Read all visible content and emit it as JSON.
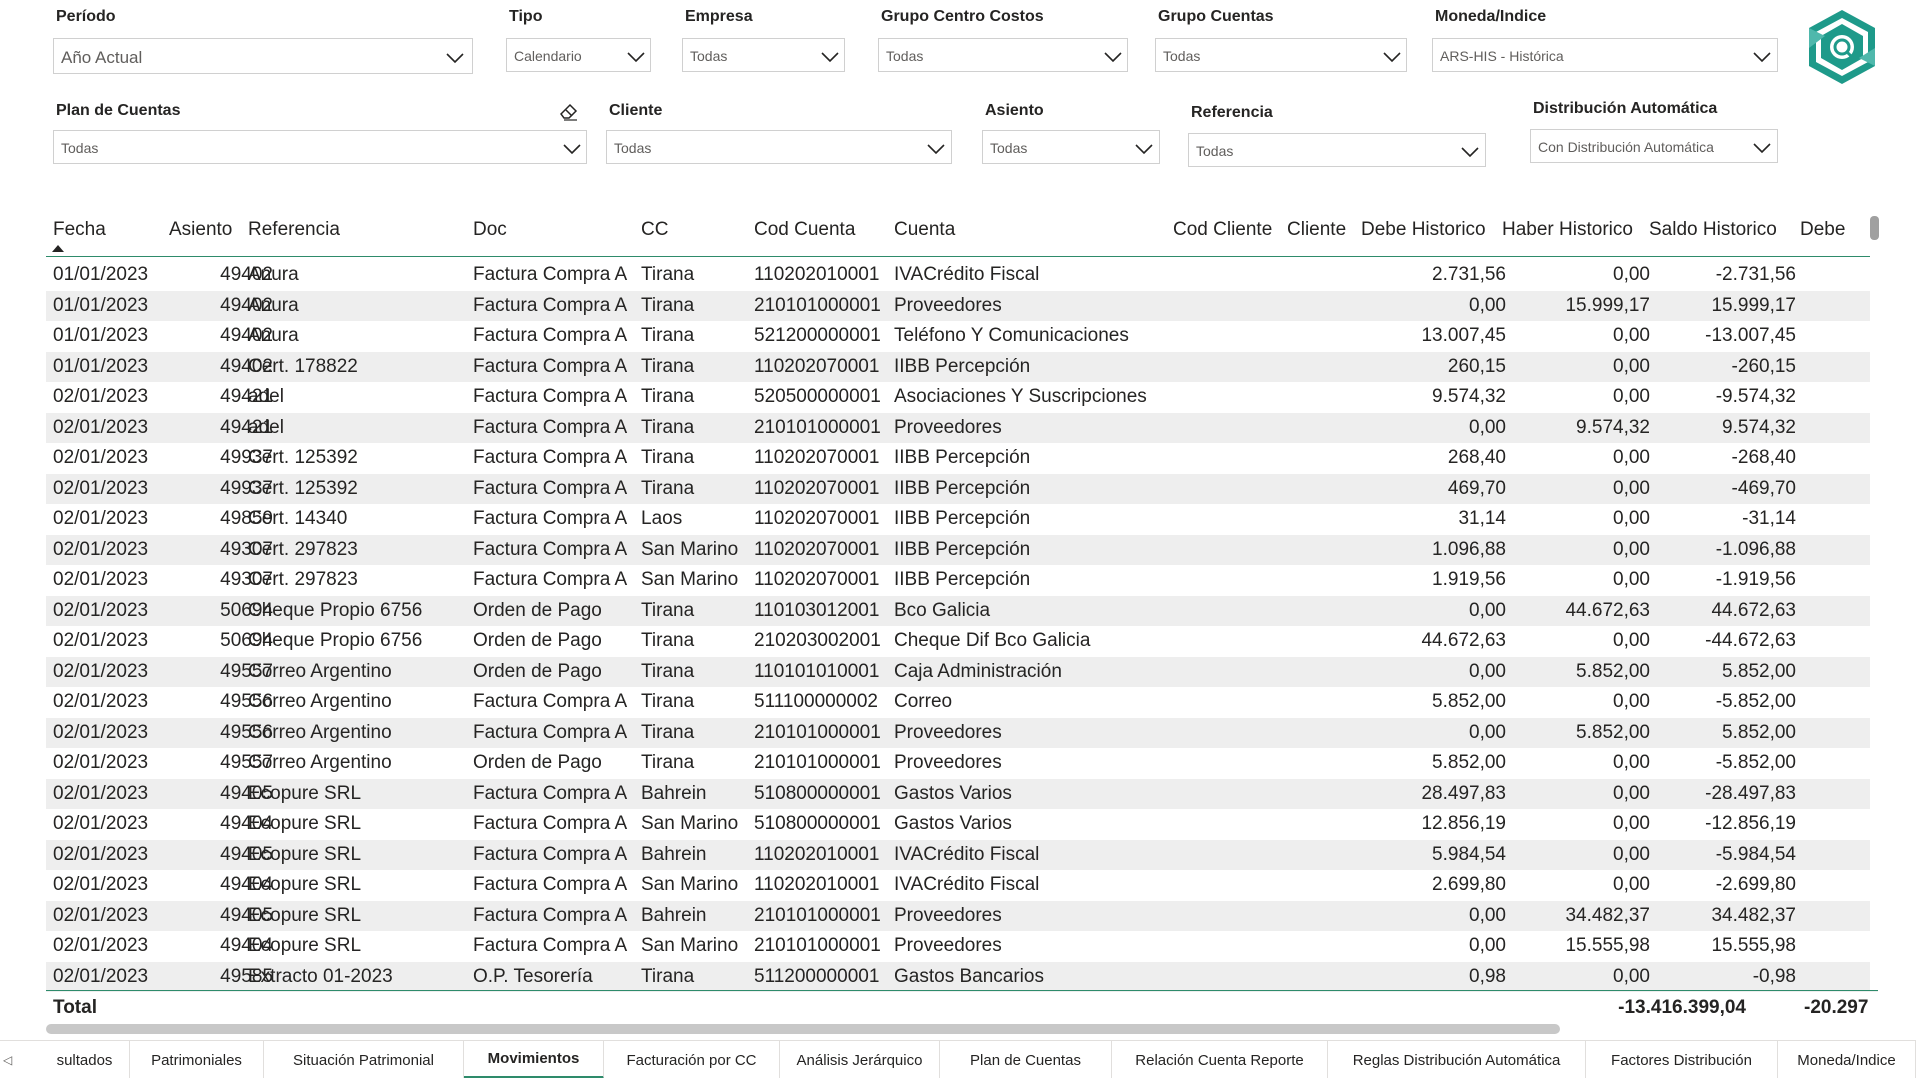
{
  "filters": {
    "periodo": {
      "label": "Período",
      "value": "Año Actual"
    },
    "tipo": {
      "label": "Tipo",
      "value": "Calendario"
    },
    "empresa": {
      "label": "Empresa",
      "value": "Todas"
    },
    "grupo_centro_costos": {
      "label": "Grupo Centro Costos",
      "value": "Todas"
    },
    "grupo_cuentas": {
      "label": "Grupo Cuentas",
      "value": "Todas"
    },
    "moneda_indice": {
      "label": "Moneda/Indice",
      "value": "ARS-HIS - Histórica"
    },
    "plan_de_cuentas": {
      "label": "Plan de Cuentas",
      "value": "Todas"
    },
    "cliente": {
      "label": "Cliente",
      "value": "Todas"
    },
    "asiento": {
      "label": "Asiento",
      "value": "Todas"
    },
    "referencia": {
      "label": "Referencia",
      "value": "Todas"
    },
    "distribucion_automatica": {
      "label": "Distribución Automática",
      "value": "Con Distribución Automática"
    }
  },
  "table": {
    "columns": [
      "Fecha",
      "Asiento",
      "Referencia",
      "Doc",
      "CC",
      "Cod Cuenta",
      "Cuenta",
      "Cod Cliente",
      "Cliente",
      "Debe Historico",
      "Haber Historico",
      "Saldo Historico",
      "Debe"
    ],
    "rows": [
      [
        "01/01/2023",
        "49402",
        "Anura",
        "Factura Compra A",
        "Tirana",
        "110202010001",
        "IVACrédito Fiscal",
        "2.731,56",
        "0,00",
        "-2.731,56"
      ],
      [
        "01/01/2023",
        "49402",
        "Anura",
        "Factura Compra A",
        "Tirana",
        "210101000001",
        "Proveedores",
        "0,00",
        "15.999,17",
        "15.999,17"
      ],
      [
        "01/01/2023",
        "49402",
        "Anura",
        "Factura Compra A",
        "Tirana",
        "521200000001",
        "Teléfono Y Comunicaciones",
        "13.007,45",
        "0,00",
        "-13.007,45"
      ],
      [
        "01/01/2023",
        "49402",
        "Cert. 178822",
        "Factura Compra A",
        "Tirana",
        "110202070001",
        "IIBB Percepción",
        "260,15",
        "0,00",
        "-260,15"
      ],
      [
        "02/01/2023",
        "49421",
        "adel",
        "Factura Compra A",
        "Tirana",
        "520500000001",
        "Asociaciones Y Suscripciones",
        "9.574,32",
        "0,00",
        "-9.574,32"
      ],
      [
        "02/01/2023",
        "49421",
        "adel",
        "Factura Compra A",
        "Tirana",
        "210101000001",
        "Proveedores",
        "0,00",
        "9.574,32",
        "9.574,32"
      ],
      [
        "02/01/2023",
        "49937",
        "Cert. 125392",
        "Factura Compra A",
        "Tirana",
        "110202070001",
        "IIBB Percepción",
        "268,40",
        "0,00",
        "-268,40"
      ],
      [
        "02/01/2023",
        "49937",
        "Cert. 125392",
        "Factura Compra A",
        "Tirana",
        "110202070001",
        "IIBB Percepción",
        "469,70",
        "0,00",
        "-469,70"
      ],
      [
        "02/01/2023",
        "49859",
        "Cert. 14340",
        "Factura Compra A",
        "Laos",
        "110202070001",
        "IIBB Percepción",
        "31,14",
        "0,00",
        "-31,14"
      ],
      [
        "02/01/2023",
        "49307",
        "Cert. 297823",
        "Factura Compra A",
        "San Marino",
        "110202070001",
        "IIBB Percepción",
        "1.096,88",
        "0,00",
        "-1.096,88"
      ],
      [
        "02/01/2023",
        "49307",
        "Cert. 297823",
        "Factura Compra A",
        "San Marino",
        "110202070001",
        "IIBB Percepción",
        "1.919,56",
        "0,00",
        "-1.919,56"
      ],
      [
        "02/01/2023",
        "50694",
        "Cheque Propio 6756",
        "Orden de Pago",
        "Tirana",
        "110103012001",
        "Bco Galicia",
        "0,00",
        "44.672,63",
        "44.672,63"
      ],
      [
        "02/01/2023",
        "50694",
        "Cheque Propio 6756",
        "Orden de Pago",
        "Tirana",
        "210203002001",
        "Cheque Dif Bco Galicia",
        "44.672,63",
        "0,00",
        "-44.672,63"
      ],
      [
        "02/01/2023",
        "49557",
        "Correo Argentino",
        "Orden de Pago",
        "Tirana",
        "110101010001",
        "Caja Administración",
        "0,00",
        "5.852,00",
        "5.852,00"
      ],
      [
        "02/01/2023",
        "49556",
        "Correo Argentino",
        "Factura Compra A",
        "Tirana",
        "511100000002",
        "Correo",
        "5.852,00",
        "0,00",
        "-5.852,00"
      ],
      [
        "02/01/2023",
        "49556",
        "Correo Argentino",
        "Factura Compra A",
        "Tirana",
        "210101000001",
        "Proveedores",
        "0,00",
        "5.852,00",
        "5.852,00"
      ],
      [
        "02/01/2023",
        "49557",
        "Correo Argentino",
        "Orden de Pago",
        "Tirana",
        "210101000001",
        "Proveedores",
        "5.852,00",
        "0,00",
        "-5.852,00"
      ],
      [
        "02/01/2023",
        "49405",
        "Ecopure SRL",
        "Factura Compra A",
        "Bahrein",
        "510800000001",
        "Gastos Varios",
        "28.497,83",
        "0,00",
        "-28.497,83"
      ],
      [
        "02/01/2023",
        "49404",
        "Ecopure SRL",
        "Factura Compra A",
        "San Marino",
        "510800000001",
        "Gastos Varios",
        "12.856,19",
        "0,00",
        "-12.856,19"
      ],
      [
        "02/01/2023",
        "49405",
        "Ecopure SRL",
        "Factura Compra A",
        "Bahrein",
        "110202010001",
        "IVACrédito Fiscal",
        "5.984,54",
        "0,00",
        "-5.984,54"
      ],
      [
        "02/01/2023",
        "49404",
        "Ecopure SRL",
        "Factura Compra A",
        "San Marino",
        "110202010001",
        "IVACrédito Fiscal",
        "2.699,80",
        "0,00",
        "-2.699,80"
      ],
      [
        "02/01/2023",
        "49405",
        "Ecopure SRL",
        "Factura Compra A",
        "Bahrein",
        "210101000001",
        "Proveedores",
        "0,00",
        "34.482,37",
        "34.482,37"
      ],
      [
        "02/01/2023",
        "49404",
        "Ecopure SRL",
        "Factura Compra A",
        "San Marino",
        "210101000001",
        "Proveedores",
        "0,00",
        "15.555,98",
        "15.555,98"
      ],
      [
        "02/01/2023",
        "49585",
        "Extracto 01-2023",
        "O.P. Tesorería",
        "Tirana",
        "511200000001",
        "Gastos Bancarios",
        "0,98",
        "0,00",
        "-0,98"
      ]
    ],
    "total_label": "Total",
    "total_saldo": "-13.416.399,04",
    "total_debe": "-20.297"
  },
  "tabs": [
    "sultados",
    "Patrimoniales",
    "Situación Patrimonial",
    "Movimientos",
    "Facturación por CC",
    "Análisis Jerárquico",
    "Plan de Cuentas",
    "Relación Cuenta Reporte",
    "Reglas Distribución Automática",
    "Factores Distribución",
    "Moneda/Indice"
  ],
  "active_tab": "Movimientos",
  "tab_nav": "◁",
  "colors": {
    "accent": "#2e8b6b",
    "logo": "#1e9a8a"
  }
}
